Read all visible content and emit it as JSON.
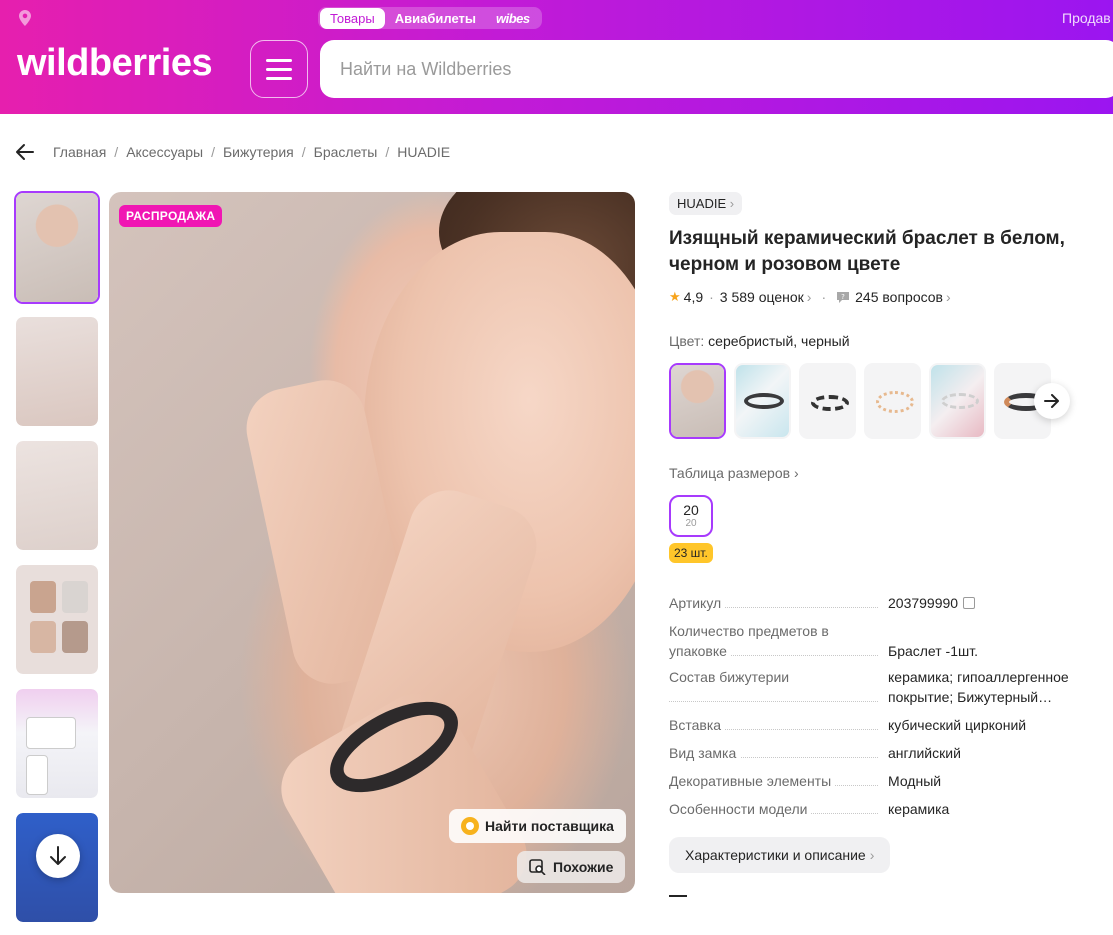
{
  "header": {
    "tabs": [
      "Товары",
      "Авиабилеты",
      "wibes"
    ],
    "seller_link": "Продав",
    "logo": "wildberries",
    "search_placeholder": "Найти на Wildberries"
  },
  "breadcrumb": [
    "Главная",
    "Аксессуары",
    "Бижутерия",
    "Браслеты",
    "HUADIE"
  ],
  "gallery": {
    "sale_badge": "РАСПРОДАЖА",
    "find_supplier": "Найти поставщика",
    "similar": "Похожие"
  },
  "product": {
    "brand": "HUADIE",
    "title": "Изящный керамический браслет в белом, черном и розовом цвете",
    "rating": "4,9",
    "reviews": "3 589 оценок",
    "questions": "245 вопросов",
    "color_label": "Цвет:",
    "color_value": "серебристый, черный",
    "size_table": "Таблица размеров",
    "size_main": "20",
    "size_sub": "20",
    "stock": "23 шт.",
    "specs": [
      {
        "k": "Артикул",
        "v": "203799990"
      },
      {
        "k": "Количество предметов в упаковке",
        "v": "Браслет -1шт."
      },
      {
        "k": "Состав бижутерии",
        "v": "керамика; гипоаллергенное покрытие; Бижутерный…"
      },
      {
        "k": "Вставка",
        "v": "кубический цирконий"
      },
      {
        "k": "Вид замка",
        "v": "английский"
      },
      {
        "k": "Декоративные элементы",
        "v": "Модный"
      },
      {
        "k": "Особенности модели",
        "v": "керамика"
      }
    ],
    "characteristics_button": "Характеристики и описание"
  },
  "colors": {
    "accent": "#a73afd",
    "sale": "#f016b3",
    "stock": "#ffc62a",
    "star": "#f7a41d"
  }
}
